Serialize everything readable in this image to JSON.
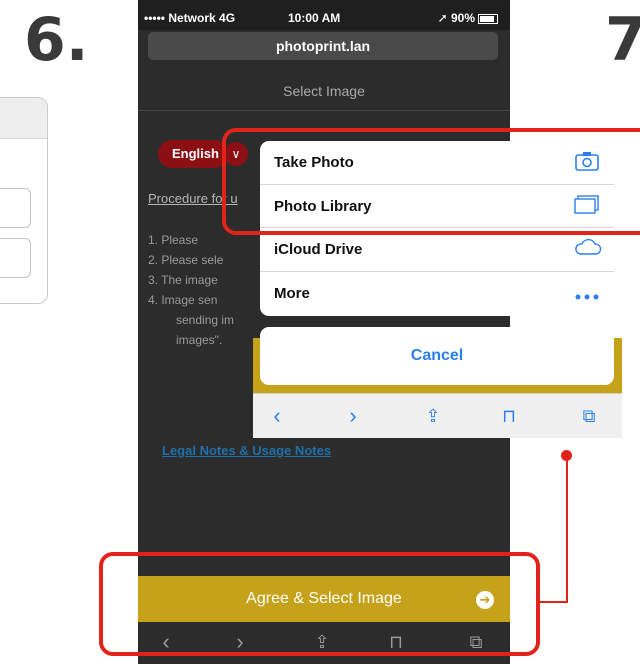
{
  "steps": {
    "left": "6.",
    "right": "7"
  },
  "statusbar": {
    "carrier": "••••• Network 4G",
    "time": "10:00 AM",
    "battery": "➚ 90%"
  },
  "browser": {
    "url": "photoprint.lan"
  },
  "page": {
    "title": "Select Image",
    "language": "English",
    "procedure_link": "Procedure for u",
    "steps": [
      "1. Please ",
      "2. Please sele",
      "3. The image",
      "4. Image sen",
      "sending im",
      "images\"."
    ],
    "legal_link": "Legal Notes & Usage Notes",
    "agree_button": "Agree & Select Image"
  },
  "action_sheet": {
    "items": [
      {
        "label": "Take Photo",
        "icon": "camera-icon"
      },
      {
        "label": "Photo Library",
        "icon": "photo-library-icon"
      },
      {
        "label": "iCloud Drive",
        "icon": "cloud-icon"
      },
      {
        "label": "More",
        "icon": "more-dots-icon"
      }
    ],
    "cancel": "Cancel"
  },
  "colors": {
    "highlight": "#e2231a",
    "agree_bar": "#c6a11a",
    "ios_blue": "#2a7ff0",
    "language_button": "#8c0f14"
  }
}
